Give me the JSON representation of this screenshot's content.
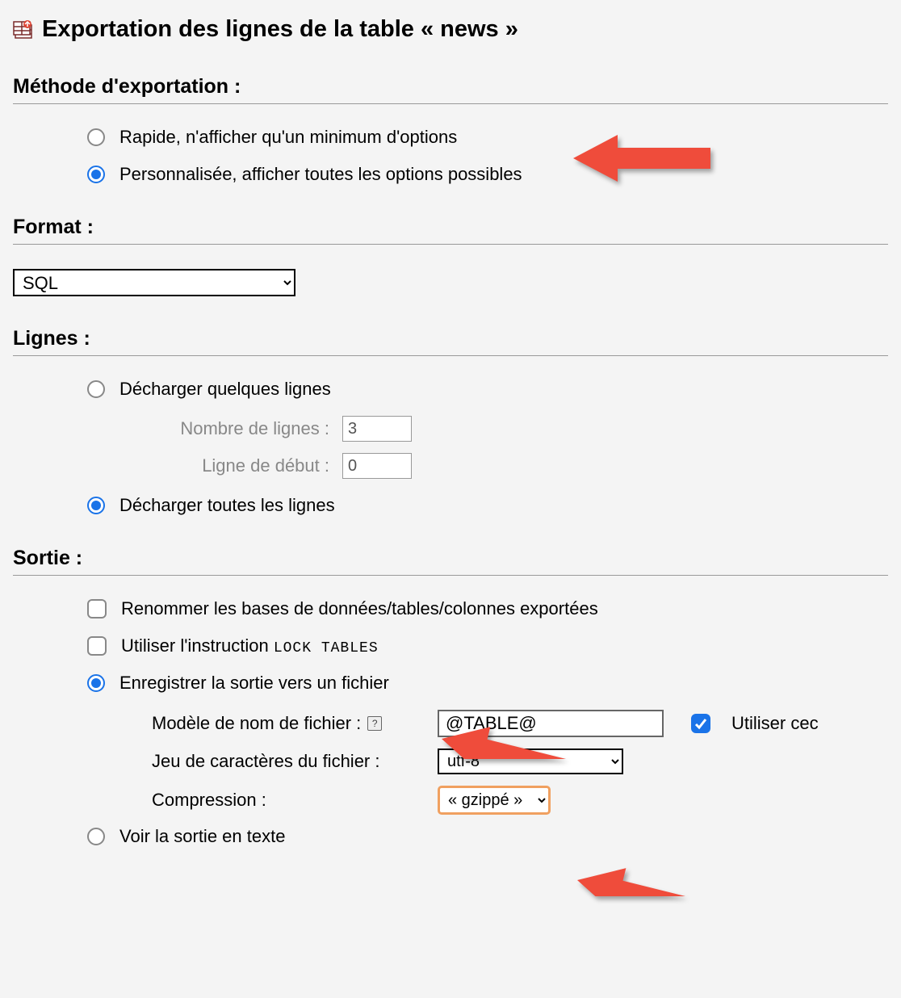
{
  "title": "Exportation des lignes de la table « news »",
  "method": {
    "heading": "Méthode d'exportation :",
    "rapid": "Rapide, n'afficher qu'un minimum d'options",
    "custom": "Personnalisée, afficher toutes les options possibles",
    "selected": "custom"
  },
  "format": {
    "heading": "Format :",
    "value": "SQL"
  },
  "rows": {
    "heading": "Lignes :",
    "some": "Décharger quelques lignes",
    "count_label": "Nombre de lignes :",
    "count_value": "3",
    "start_label": "Ligne de début :",
    "start_value": "0",
    "all": "Décharger toutes les lignes",
    "selected": "all"
  },
  "output": {
    "heading": "Sortie :",
    "rename": "Renommer les bases de données/tables/colonnes exportées",
    "use_lock_prefix": "Utiliser l'instruction ",
    "lock_mono": "LOCK TABLES",
    "save_file": "Enregistrer la sortie vers un fichier",
    "filename_template_label": "Modèle de nom de fichier :",
    "filename_template_value": "@TABLE@",
    "use_this": "Utiliser cec",
    "charset_label": "Jeu de caractères du fichier :",
    "charset_value": "utf-8",
    "compression_label": "Compression :",
    "compression_value": "« gzippé »",
    "view_text": "Voir la sortie en texte",
    "output_selected": "save_file"
  }
}
